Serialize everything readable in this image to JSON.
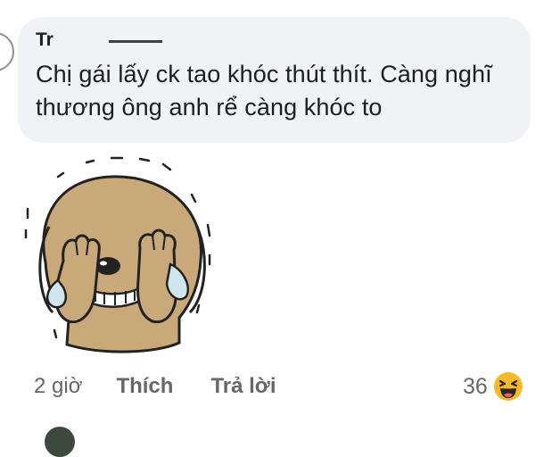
{
  "comment": {
    "author_name": "Tr",
    "text": "Chị gái lấy ck tao khóc thút thít. Càng nghĩ thương ông anh rể càng khóc to"
  },
  "sticker": {
    "icon": "crying-dog-sticker"
  },
  "actions": {
    "time": "2 giờ",
    "like_label": "Thích",
    "reply_label": "Trả lời"
  },
  "reactions": {
    "count": "36",
    "icon": "haha-emoji-icon",
    "color": "#f7b928"
  },
  "colors": {
    "bubble": "#f0f2f5",
    "text": "#1c1e21",
    "secondary": "#65676b",
    "sticker_fur": "#c9a97a"
  }
}
